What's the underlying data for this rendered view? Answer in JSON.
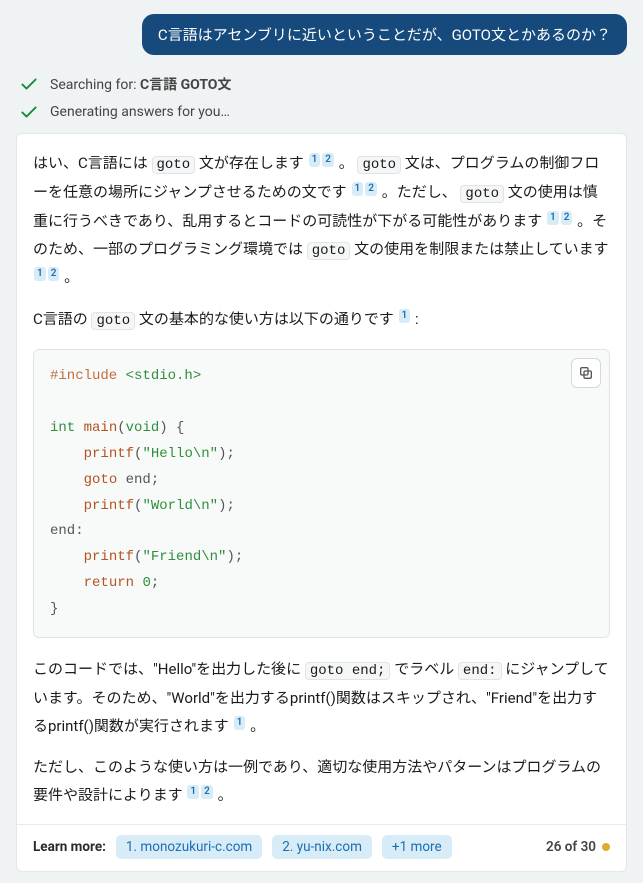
{
  "user_message": "C言語はアセンブリに近いということだが、GOTO文とかあるのか？",
  "status": {
    "searching_prefix": "Searching for: ",
    "searching_query": "C言語 GOTO文",
    "generating": "Generating answers for you…"
  },
  "answer": {
    "p1_a": "はい、C言語には ",
    "goto": "goto",
    "p1_b": " 文が存在します ",
    "p1_c": " 。 ",
    "p1_d": " 文は、プログラムの制御フローを任意の場所にジャンプさせるための文です ",
    "p1_e": " 。ただし、 ",
    "p1_f": " 文の使用は慎重に行うべきであり、乱用するとコードの可読性が下がる可能性があります ",
    "p1_g": " 。そのため、一部のプログラミング環境では ",
    "p1_h": " 文の使用を制限または禁止しています ",
    "p1_i": " 。",
    "p2_a": "C言語の ",
    "p2_b": " 文の基本的な使い方は以下の通りです ",
    "p2_c": " :",
    "p3_a": "このコードでは、\"Hello\"を出力した後に ",
    "goto_end_stmt": "goto end;",
    "p3_b": " でラベル ",
    "end_label": "end:",
    "p3_c": " にジャンプしています。そのため、\"World\"を出力するprintf()関数はスキップされ、\"Friend\"を出力するprintf()関数が実行されます ",
    "p3_d": " 。",
    "p4_a": "ただし、このような使い方は一例であり、適切な使用方法やパターンはプログラムの要件や設計によります ",
    "p4_b": " 。"
  },
  "citations": {
    "one": "1",
    "two": "2"
  },
  "code": {
    "include": "#include",
    "stdio": "<stdio.h>",
    "int": "int",
    "main": "main",
    "void": "void",
    "printf": "printf",
    "hello": "\"Hello\\n\"",
    "world": "\"World\\n\"",
    "friend": "\"Friend\\n\"",
    "goto": "goto",
    "end": "end",
    "endlbl": "end:",
    "return": "return",
    "zero": "0"
  },
  "footer": {
    "learn_label": "Learn more:",
    "source1": "1. monozukuri-c.com",
    "source2": "2. yu-nix.com",
    "more": "+1 more",
    "counter": "26 of 30"
  }
}
